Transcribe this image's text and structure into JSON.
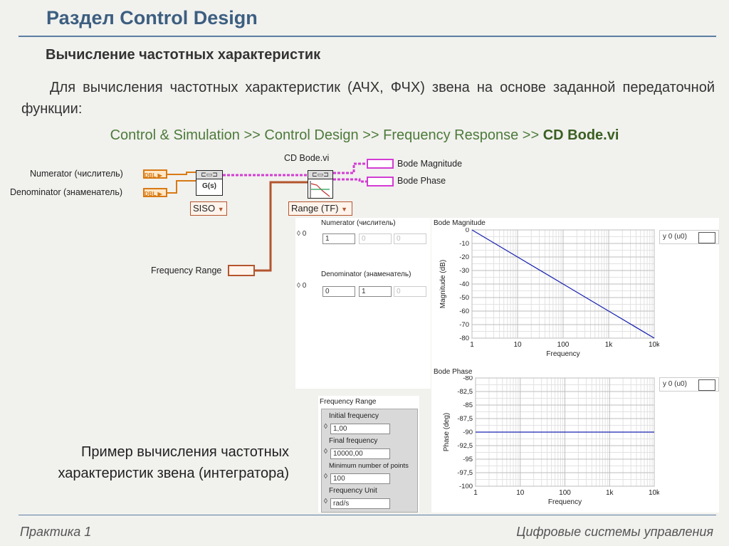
{
  "slide": {
    "title": "Раздел Control Design",
    "subtitle": "Вычисление частотных характеристик",
    "paragraph": "Для вычисления частотных характеристик (АЧХ, ФЧХ) звена на основе заданной передаточной функции:",
    "path_prefix": "Control & Simulation >> Control Design >> Frequency Response >> ",
    "path_bold": "CD Bode.vi",
    "caption": "Пример вычисления частотных характеристик звена (интегратора)",
    "footer_left": "Практика 1",
    "footer_right": "Цифровые системы управления"
  },
  "block_diagram": {
    "numerator_label": "Numerator (числитель)",
    "denominator_label": "Denominator (знаменатель)",
    "frequency_range_label": "Frequency Range",
    "dbl_tag": "DBL",
    "tf_node_label": "G(s)",
    "siso_label": "SISO",
    "vi_name": "CD Bode.vi",
    "range_label": "Range (TF)",
    "output_magnitude": "Bode Magnitude",
    "output_phase": "Bode Phase"
  },
  "front_panel": {
    "numerator_label": "Numerator (числитель)",
    "numerator_index": "0",
    "numerator_values": [
      "1",
      "0",
      "0"
    ],
    "denominator_label": "Denominator (знаменатель)",
    "denominator_index": "0",
    "denominator_values": [
      "0",
      "1",
      "0"
    ],
    "frequency_range": {
      "title": "Frequency Range",
      "initial_label": "Initial frequency",
      "initial_value": "1,00",
      "final_label": "Final frequency",
      "final_value": "10000,00",
      "min_points_label": "Minimum number of points",
      "min_points_value": "100",
      "unit_label": "Frequency Unit",
      "unit_value": "rad/s"
    },
    "legend_text": "y 0 (u0)"
  },
  "chart_data": [
    {
      "type": "line",
      "title": "Bode Magnitude",
      "xlabel": "Frequency",
      "ylabel": "Magnitude (dB)",
      "x_scale": "log",
      "xlim": [
        1,
        10000
      ],
      "ylim": [
        -80,
        0
      ],
      "x_ticks": [
        "1",
        "10",
        "100",
        "1k",
        "10k"
      ],
      "y_ticks": [
        "0",
        "-10",
        "-20",
        "-30",
        "-40",
        "-50",
        "-60",
        "-70",
        "-80"
      ],
      "grid": true,
      "legend": "top-right",
      "series": [
        {
          "name": "y 0 (u0)",
          "x": [
            1,
            10,
            100,
            1000,
            10000
          ],
          "y": [
            0,
            -20,
            -40,
            -60,
            -80
          ],
          "color": "#1a23b0"
        }
      ]
    },
    {
      "type": "line",
      "title": "Bode Phase",
      "xlabel": "Frequency",
      "ylabel": "Phase (deg)",
      "x_scale": "log",
      "xlim": [
        1,
        10000
      ],
      "ylim": [
        -100,
        -80
      ],
      "x_ticks": [
        "1",
        "10",
        "100",
        "1k",
        "10k"
      ],
      "y_ticks": [
        "-80",
        "-82,5",
        "-85",
        "-87,5",
        "-90",
        "-92,5",
        "-95",
        "-97,5",
        "-100"
      ],
      "grid": true,
      "legend": "top-right",
      "series": [
        {
          "name": "y 0 (u0)",
          "x": [
            1,
            10,
            100,
            1000,
            10000
          ],
          "y": [
            -90,
            -90,
            -90,
            -90,
            -90
          ],
          "color": "#1a23b0"
        }
      ]
    }
  ],
  "colors": {
    "title": "#3c5e80",
    "path_green": "#4d7a3a",
    "wire_orange": "#d87a14",
    "wire_pink": "#d43cd4",
    "wire_brown": "#b4552e",
    "plot_line": "#1a23b0"
  }
}
